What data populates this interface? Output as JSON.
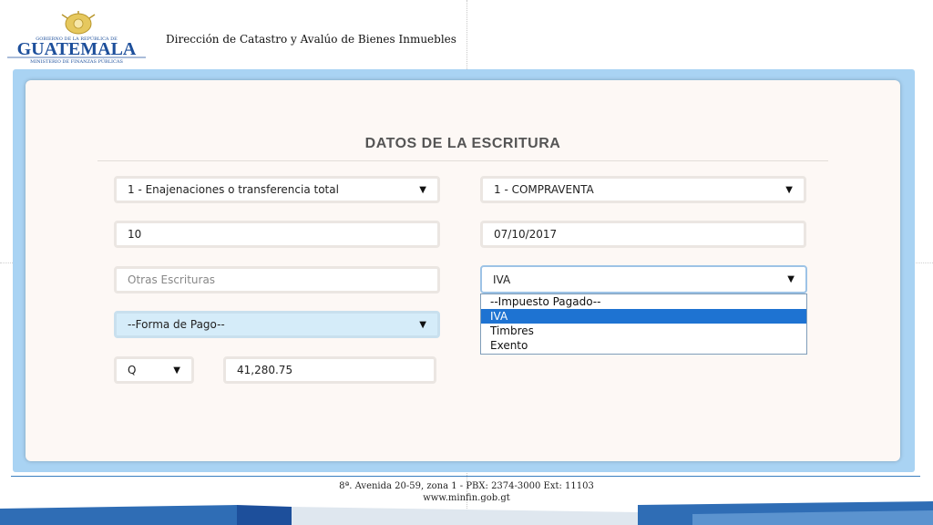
{
  "header": {
    "logo": {
      "top_text": "GOBIERNO DE LA REPÚBLICA DE",
      "name": "GUATEMALA",
      "sub_text": "MINISTERIO DE FINANZAS PÚBLICAS"
    },
    "title": "Dirección de Catastro y Avalúo de Bienes Inmuebles"
  },
  "form": {
    "title": "DATOS DE LA ESCRITURA",
    "tipo_operacion": {
      "value": "1 - Enajenaciones o transferencia total"
    },
    "tipo_escritura": {
      "value": "1 - COMPRAVENTA"
    },
    "numero": {
      "value": "10"
    },
    "fecha": {
      "value": "07/10/2017"
    },
    "otras_escrituras": {
      "value": "",
      "placeholder": "Otras Escrituras"
    },
    "impuesto": {
      "value": "IVA",
      "options": [
        "--Impuesto Pagado--",
        "IVA",
        "Timbres",
        "Exento"
      ],
      "selected_index": 1
    },
    "forma_pago": {
      "value": "--Forma de Pago--"
    },
    "moneda": {
      "value": "Q"
    },
    "monto": {
      "value": "41,280.75"
    }
  },
  "footer": {
    "address": "8ª. Avenida 20-59, zona 1 -  PBX: 2374-3000  Ext: 11103",
    "website": "www.minfin.gob.gt"
  },
  "colors": {
    "frame": "#a9d3f3",
    "panel": "#fdf8f5",
    "selected_option": "#1e73d2",
    "forma_pago_bg": "#d5ecf9",
    "logo_blue": "#1d4f9b",
    "logo_gold": "#d7b44a"
  }
}
